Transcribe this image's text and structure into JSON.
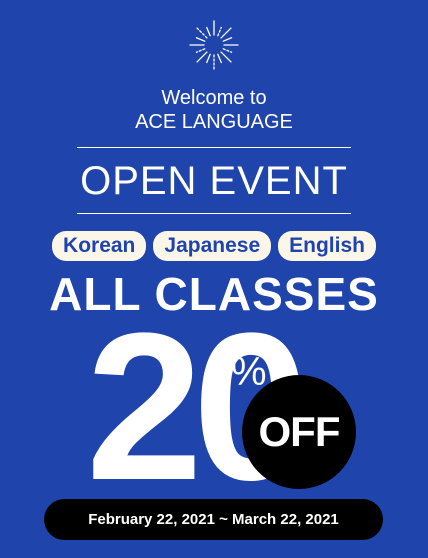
{
  "welcome": {
    "line1": "Welcome to",
    "line2": "ACE LANGUAGE"
  },
  "event_title": "OPEN EVENT",
  "tags": [
    "Korean",
    "Japanese",
    "English"
  ],
  "headline": "ALL CLASSES",
  "discount": {
    "value": "20",
    "percent_sign": "%",
    "off_label": "OFF"
  },
  "date_range": "February 22, 2021 ~ March 22, 2021",
  "colors": {
    "background": "#1f45ad",
    "tag_background": "#fcf6e8",
    "accent_black": "#000000",
    "text": "#ffffff"
  },
  "icons": [
    "firework-burst-icon"
  ]
}
